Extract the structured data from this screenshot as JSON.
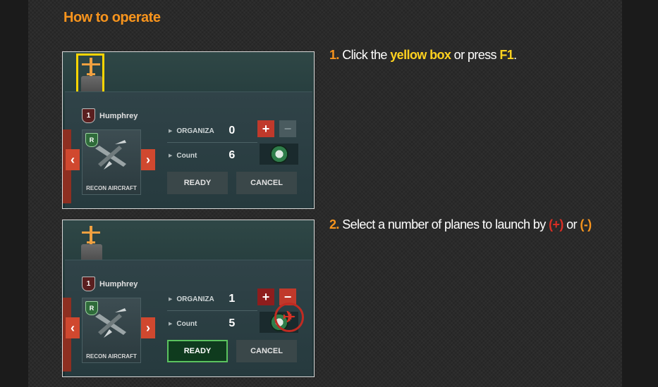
{
  "section_title": "How to operate",
  "colors": {
    "accent_orange": "#f7941d",
    "highlight_yellow": "#ffd21f",
    "plus_red": "#d82e24"
  },
  "screenshot1": {
    "commander_rank": "1",
    "commander_name": "Humphrey",
    "unit_label": "RECON AIRCRAFT",
    "unit_rank": "R",
    "organize_label": "ORGANIZA",
    "organize_value": "0",
    "count_label": "Count",
    "count_value": "6",
    "plus_label": "+",
    "minus_label": "−",
    "ready_label": "READY",
    "cancel_label": "CANCEL",
    "left_arrow": "‹",
    "right_arrow": "›"
  },
  "screenshot2": {
    "commander_rank": "1",
    "commander_name": "Humphrey",
    "unit_label": "RECON AIRCRAFT",
    "unit_rank": "R",
    "organize_label": "ORGANIZA",
    "organize_value": "1",
    "count_label": "Count",
    "count_value": "5",
    "plus_label": "+",
    "minus_label": "−",
    "ready_label": "READY",
    "cancel_label": "CANCEL",
    "left_arrow": "‹",
    "right_arrow": "›"
  },
  "step1": {
    "number": "1.",
    "text_a": " Click the ",
    "highlight": "yellow box",
    "text_b": " or press ",
    "key": "F1",
    "text_c": "."
  },
  "step2": {
    "number": "2.",
    "text_a": " Select a number of planes to launch by ",
    "plus": "(+)",
    "text_b": " or ",
    "minus": "(-)"
  }
}
